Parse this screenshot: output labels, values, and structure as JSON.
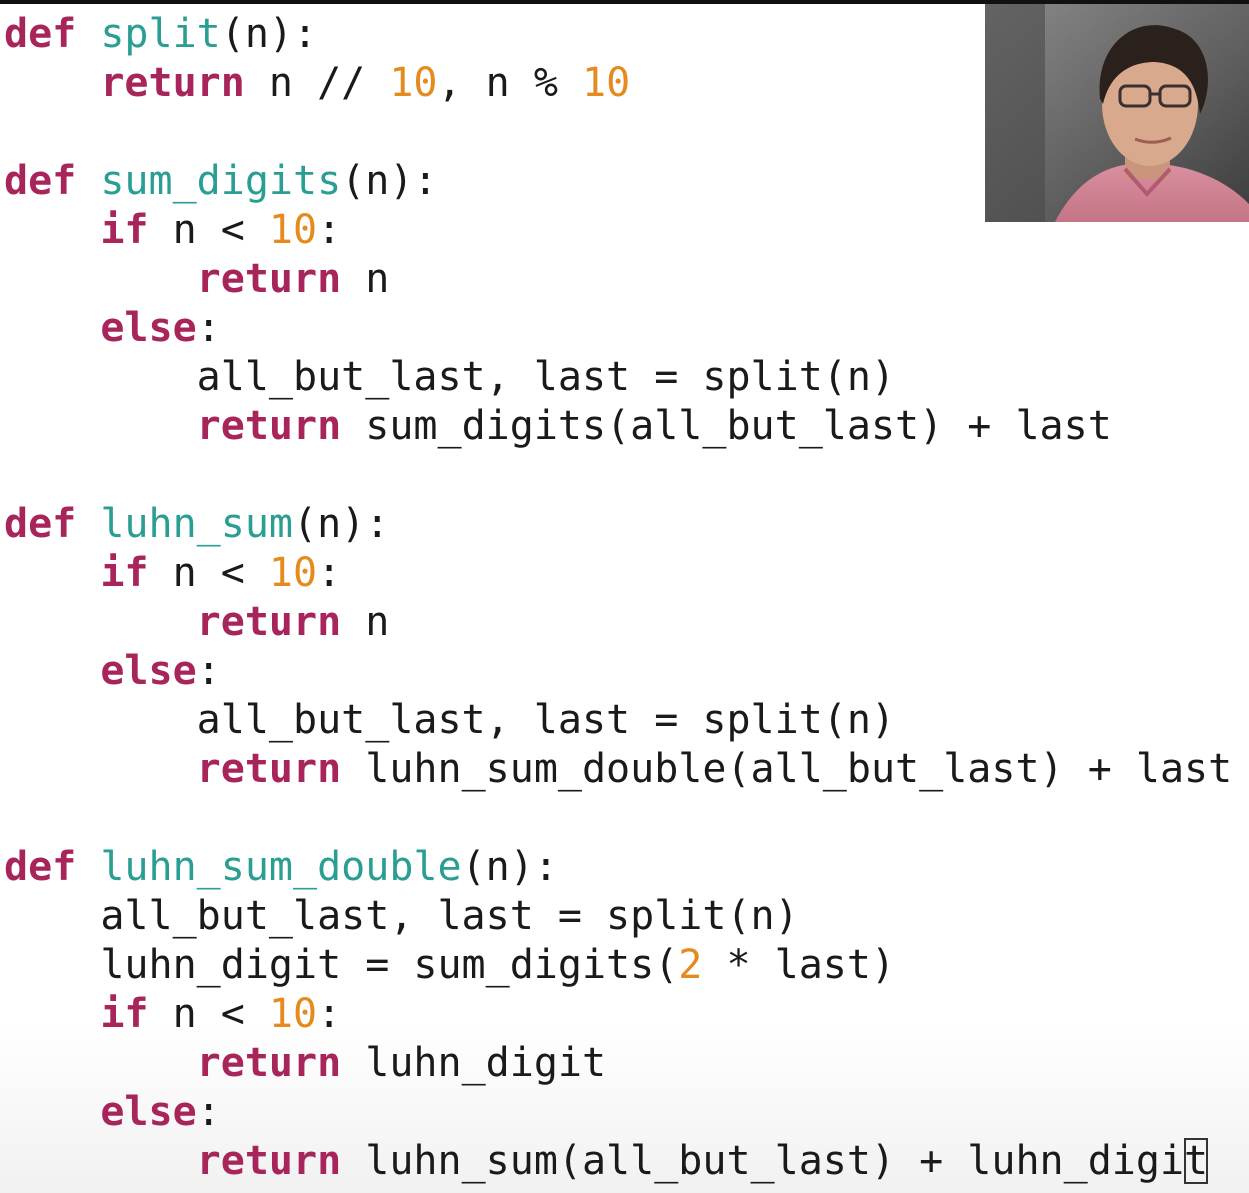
{
  "code": {
    "lines": [
      [
        [
          "kw",
          "def"
        ],
        [
          "txt",
          " "
        ],
        [
          "fn",
          "split"
        ],
        [
          "txt",
          "(n):"
        ]
      ],
      [
        [
          "txt",
          "    "
        ],
        [
          "kw",
          "return"
        ],
        [
          "txt",
          " n // "
        ],
        [
          "num",
          "10"
        ],
        [
          "txt",
          ", n % "
        ],
        [
          "num",
          "10"
        ]
      ],
      [],
      [
        [
          "kw",
          "def"
        ],
        [
          "txt",
          " "
        ],
        [
          "fn",
          "sum_digits"
        ],
        [
          "txt",
          "(n):"
        ]
      ],
      [
        [
          "txt",
          "    "
        ],
        [
          "kw",
          "if"
        ],
        [
          "txt",
          " n < "
        ],
        [
          "num",
          "10"
        ],
        [
          "txt",
          ":"
        ]
      ],
      [
        [
          "txt",
          "        "
        ],
        [
          "kw",
          "return"
        ],
        [
          "txt",
          " n"
        ]
      ],
      [
        [
          "txt",
          "    "
        ],
        [
          "kw",
          "else"
        ],
        [
          "txt",
          ":"
        ]
      ],
      [
        [
          "txt",
          "        all_but_last, last = split(n)"
        ]
      ],
      [
        [
          "txt",
          "        "
        ],
        [
          "kw",
          "return"
        ],
        [
          "txt",
          " sum_digits(all_but_last) + last"
        ]
      ],
      [],
      [
        [
          "kw",
          "def"
        ],
        [
          "txt",
          " "
        ],
        [
          "fn",
          "luhn_sum"
        ],
        [
          "txt",
          "(n):"
        ]
      ],
      [
        [
          "txt",
          "    "
        ],
        [
          "kw",
          "if"
        ],
        [
          "txt",
          " n < "
        ],
        [
          "num",
          "10"
        ],
        [
          "txt",
          ":"
        ]
      ],
      [
        [
          "txt",
          "        "
        ],
        [
          "kw",
          "return"
        ],
        [
          "txt",
          " n"
        ]
      ],
      [
        [
          "txt",
          "    "
        ],
        [
          "kw",
          "else"
        ],
        [
          "txt",
          ":"
        ]
      ],
      [
        [
          "txt",
          "        all_but_last, last = split(n)"
        ]
      ],
      [
        [
          "txt",
          "        "
        ],
        [
          "kw",
          "return"
        ],
        [
          "txt",
          " luhn_sum_double(all_but_last) + last"
        ]
      ],
      [],
      [
        [
          "kw",
          "def"
        ],
        [
          "txt",
          " "
        ],
        [
          "fn",
          "luhn_sum_double"
        ],
        [
          "txt",
          "(n):"
        ]
      ],
      [
        [
          "txt",
          "    all_but_last, last = split(n)"
        ]
      ],
      [
        [
          "txt",
          "    luhn_digit = sum_digits("
        ],
        [
          "num",
          "2"
        ],
        [
          "txt",
          " * last)"
        ]
      ],
      [
        [
          "txt",
          "    "
        ],
        [
          "kw",
          "if"
        ],
        [
          "txt",
          " n < "
        ],
        [
          "num",
          "10"
        ],
        [
          "txt",
          ":"
        ]
      ],
      [
        [
          "txt",
          "        "
        ],
        [
          "kw",
          "return"
        ],
        [
          "txt",
          " luhn_digit"
        ]
      ],
      [
        [
          "txt",
          "    "
        ],
        [
          "kw",
          "else"
        ],
        [
          "txt",
          ":"
        ]
      ],
      [
        [
          "txt",
          "        "
        ],
        [
          "kw",
          "return"
        ],
        [
          "txt",
          " luhn_sum(all_but_last) + luhn_digi"
        ],
        [
          "cursor",
          "t"
        ]
      ]
    ]
  },
  "colors": {
    "keyword": "#a8255b",
    "function_name": "#2a9e92",
    "number": "#e58a1f",
    "text": "#1a1a1a"
  },
  "webcam": {
    "description": "presenter-video"
  }
}
